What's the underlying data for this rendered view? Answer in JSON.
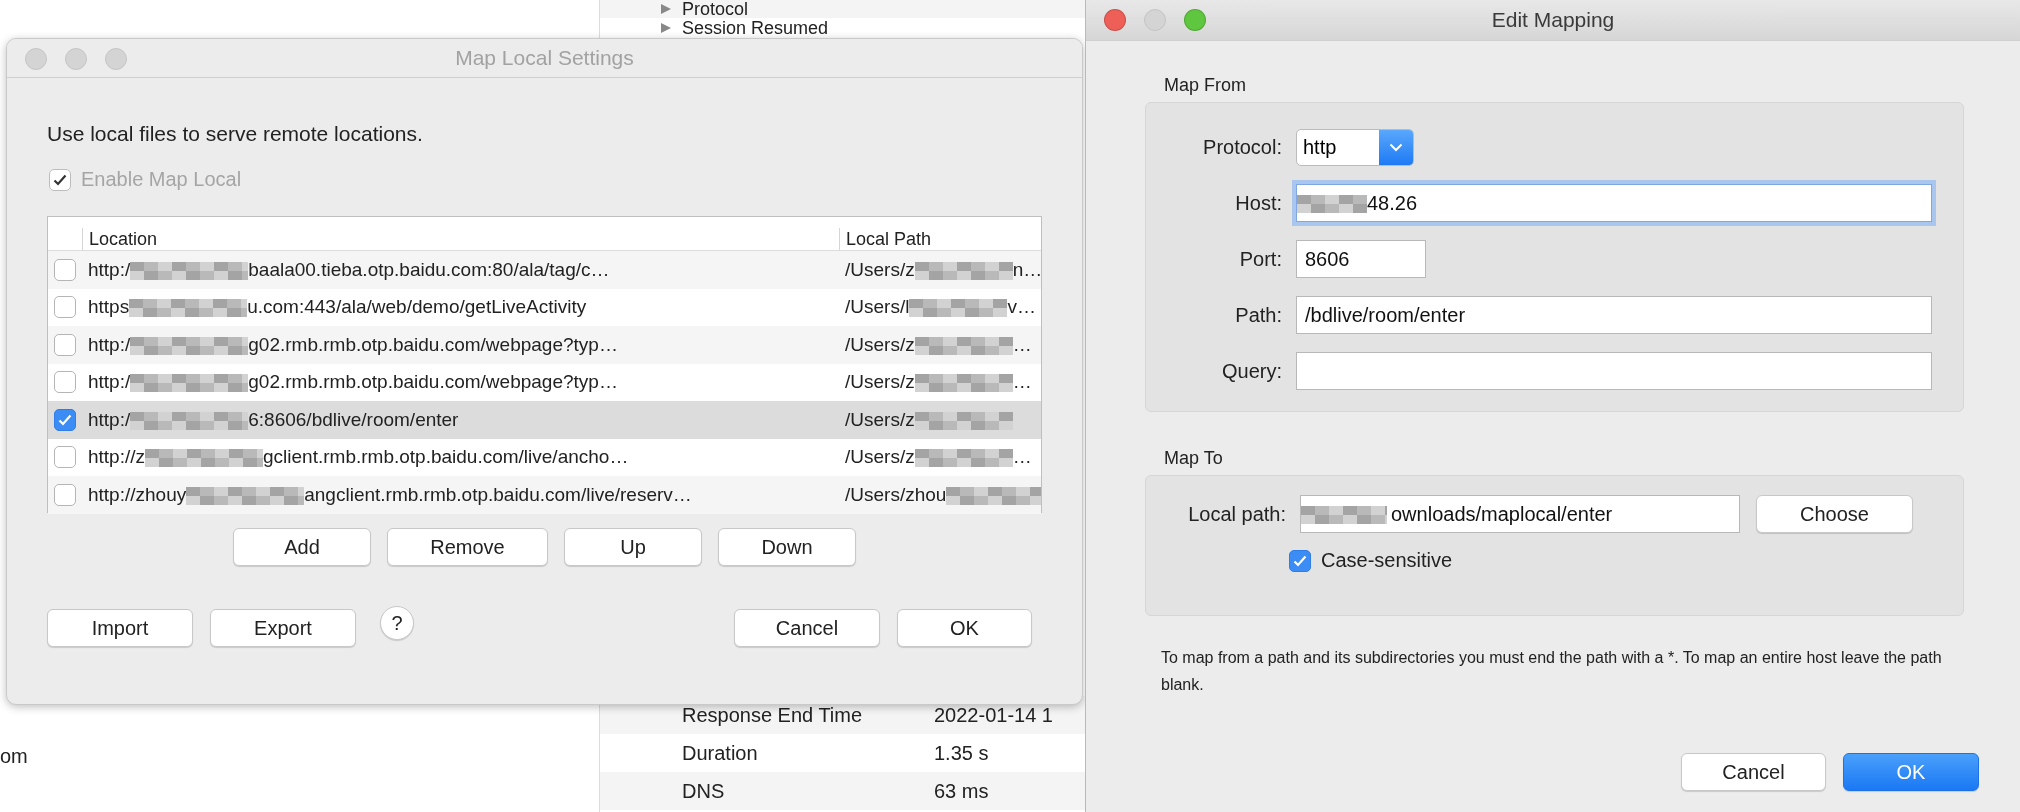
{
  "background": {
    "left_fragment": "om",
    "details": [
      {
        "label": "Protocol",
        "expander": true
      },
      {
        "label": "Session Resumed",
        "expander": true
      },
      {
        "label": "Response End Time",
        "value": "2022-01-14 1",
        "expander": false
      },
      {
        "label": "Duration",
        "value": "1.35 s",
        "expander": false
      },
      {
        "label": "DNS",
        "value": "63 ms",
        "expander": false
      }
    ]
  },
  "map_local": {
    "window": {
      "title": "Map Local Settings",
      "controls": [
        {
          "active": false
        },
        {
          "active": false
        },
        {
          "active": false
        }
      ]
    },
    "intro": "Use local files to serve remote locations.",
    "enable": {
      "label": "Enable Map Local",
      "checked": true,
      "disabled": true
    },
    "columns": [
      "Location",
      "Local Path"
    ],
    "rows": [
      {
        "checked": false,
        "selected": false,
        "location": {
          "before": "http:/",
          "after": "baala00.tieba.otp.baidu.com:80/ala/tag/c…"
        },
        "local_path": {
          "before": "/Users/z",
          "after": "n…"
        }
      },
      {
        "checked": false,
        "selected": false,
        "location": {
          "before": "https",
          "after": "u.com:443/ala/web/demo/getLiveActivity"
        },
        "local_path": {
          "before": "/Users/l",
          "after": "v…"
        }
      },
      {
        "checked": false,
        "selected": false,
        "location": {
          "before": "http:/",
          "after": "g02.rmb.rmb.otp.baidu.com/webpage?typ…"
        },
        "local_path": {
          "before": "/Users/z",
          "after": "…"
        }
      },
      {
        "checked": false,
        "selected": false,
        "location": {
          "before": "http:/",
          "after": "g02.rmb.rmb.otp.baidu.com/webpage?typ…"
        },
        "local_path": {
          "before": "/Users/z",
          "after": "…"
        }
      },
      {
        "checked": true,
        "selected": true,
        "location": {
          "before": "http:/",
          "after": "6:8606/bdlive/room/enter"
        },
        "local_path": {
          "before": "/Users/z"
        }
      },
      {
        "checked": false,
        "selected": false,
        "location": {
          "before": "http://z",
          "after": "gclient.rmb.rmb.otp.baidu.com/live/ancho…"
        },
        "local_path": {
          "before": "/Users/z",
          "after": "…"
        }
      },
      {
        "checked": false,
        "selected": false,
        "location": {
          "before": "http://zhouy",
          "after": "angclient.rmb.rmb.otp.baidu.com/live/reserv…"
        },
        "local_path": {
          "before": "/Users/zhou"
        }
      }
    ],
    "row_buttons": [
      "Add",
      "Remove",
      "Up",
      "Down"
    ],
    "left_buttons": [
      "Import",
      "Export"
    ],
    "help": "?",
    "right_buttons": [
      {
        "label": "Cancel",
        "default": false
      },
      {
        "label": "OK",
        "default": false
      }
    ]
  },
  "edit_mapping": {
    "window": {
      "title": "Edit Mapping",
      "controls": [
        {
          "active": true
        },
        {
          "active": false
        },
        {
          "active": true
        }
      ]
    },
    "map_from": {
      "title": "Map From",
      "fields": [
        {
          "kind": "select",
          "label": "Protocol:",
          "value": "http"
        },
        {
          "kind": "text",
          "label": "Host:",
          "value": "48.26",
          "redacted": true,
          "focused": true
        },
        {
          "kind": "number",
          "label": "Port:",
          "value": "8606",
          "redacted": false,
          "focused": false
        },
        {
          "kind": "text",
          "label": "Path:",
          "value": "/bdlive/room/enter",
          "redacted": false,
          "focused": false
        },
        {
          "kind": "text",
          "label": "Query:",
          "redacted": false,
          "focused": false
        }
      ]
    },
    "map_to": {
      "title": "Map To",
      "local_path": {
        "label": "Local path:",
        "value": "ownloads/maplocal/enter",
        "redacted": true
      },
      "choose": "Choose",
      "case_sensitive": {
        "label": "Case-sensitive",
        "checked": true
      }
    },
    "note": "To map from a path and its subdirectories you must end the path with a *. To map an entire host leave the path blank.",
    "buttons": [
      {
        "label": "Cancel",
        "default": false
      },
      {
        "label": "OK",
        "default": true
      }
    ]
  }
}
